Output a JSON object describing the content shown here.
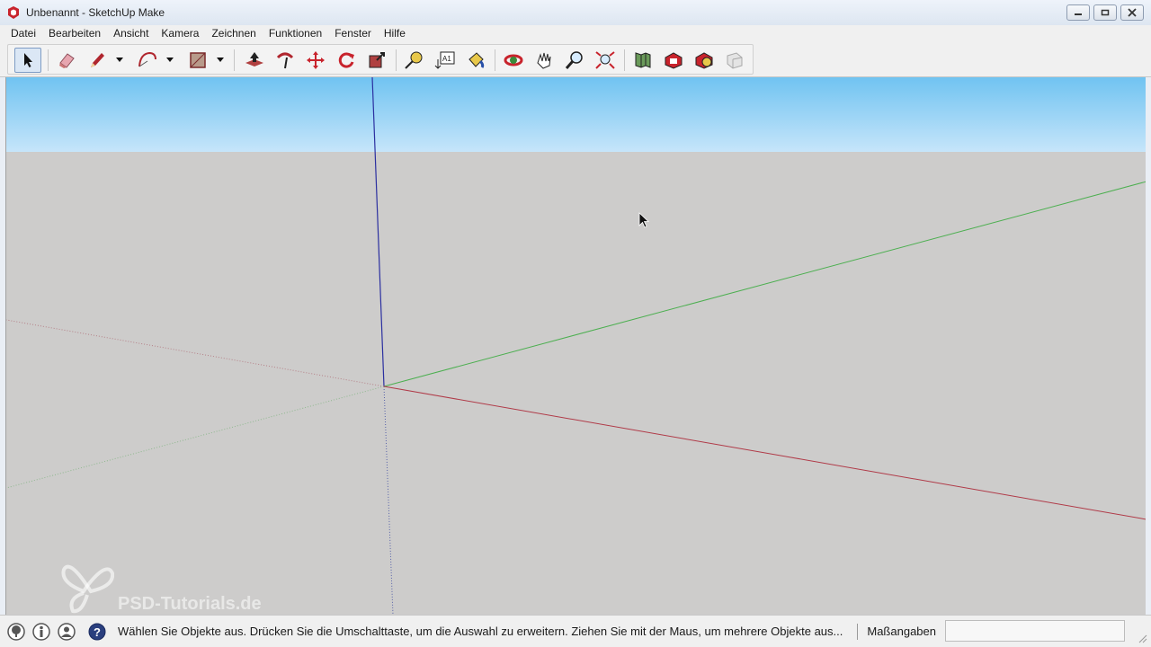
{
  "window": {
    "title": "Unbenannt - SketchUp Make"
  },
  "menu": {
    "items": [
      "Datei",
      "Bearbeiten",
      "Ansicht",
      "Kamera",
      "Zeichnen",
      "Funktionen",
      "Fenster",
      "Hilfe"
    ]
  },
  "toolbar": {
    "tools": [
      {
        "name": "select-icon",
        "active": true
      },
      {
        "name": "eraser-icon"
      },
      {
        "name": "pencil-icon"
      },
      {
        "name": "arc-icon"
      },
      {
        "name": "rectangle-icon"
      },
      {
        "name": "push-pull-icon"
      },
      {
        "name": "follow-me-icon"
      },
      {
        "name": "move-icon"
      },
      {
        "name": "rotate-icon"
      },
      {
        "name": "scale-icon"
      },
      {
        "name": "tape-measure-icon"
      },
      {
        "name": "text-icon"
      },
      {
        "name": "paint-bucket-icon"
      },
      {
        "name": "orbit-icon"
      },
      {
        "name": "pan-icon"
      },
      {
        "name": "zoom-icon"
      },
      {
        "name": "zoom-extents-icon"
      },
      {
        "name": "add-location-icon"
      },
      {
        "name": "3d-warehouse-icon"
      },
      {
        "name": "extension-warehouse-icon"
      },
      {
        "name": "layout-icon"
      }
    ]
  },
  "viewport": {
    "watermark": "PSD-Tutorials.de",
    "colors": {
      "sky_top": "#70c3f1",
      "ground": "#cdcccb",
      "red_axis": "#b03a48",
      "green_axis": "#4caf50",
      "blue_axis": "#2b2fa0"
    }
  },
  "statusbar": {
    "message": "Wählen Sie Objekte aus. Drücken Sie die Umschalttaste, um die Auswahl zu erweitern. Ziehen Sie mit der Maus, um mehrere Objekte aus...",
    "measure_label": "Maßangaben",
    "measure_value": ""
  }
}
